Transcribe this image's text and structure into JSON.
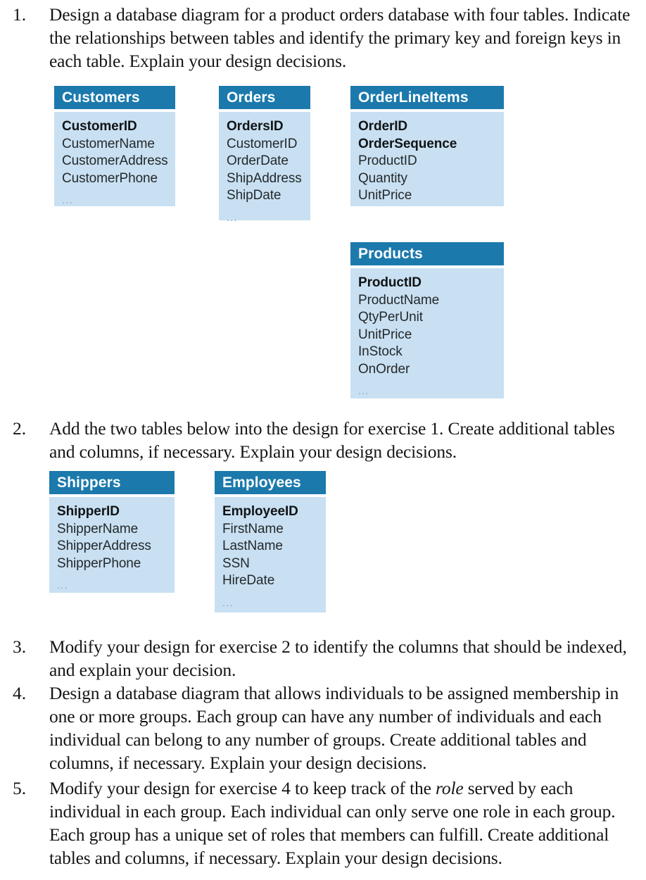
{
  "page": {
    "type": "textbook-exercise-list",
    "colors": {
      "table_header_bg": "#1b79ac",
      "table_body_bg": "#c8e0f2",
      "table_header_text": "#ffffff",
      "body_text": "#151515",
      "ellipsis": "#8aa9c4"
    }
  },
  "exercises": [
    {
      "number": "1.",
      "text": "Design a database diagram for a product orders database with four tables. Indicate the relationships between tables and identify the primary key and foreign keys in each table. Explain your design decisions."
    },
    {
      "number": "2.",
      "text": "Add the two tables below into the design for exercise 1. Create additional tables and columns, if necessary. Explain your design decisions."
    },
    {
      "number": "3.",
      "text": "Modify your design for exercise 2 to identify the columns that should be indexed, and explain your decision."
    },
    {
      "number": "4.",
      "text": "Design a database diagram that allows individuals to be assigned membership in one or more groups. Each group can have any number of individuals and each individual can belong to any number of groups. Create additional tables and columns, if necessary. Explain your design decisions."
    },
    {
      "number": "5.",
      "text_before_italic": "Modify your design for exercise 4 to keep track of the ",
      "italic_word": "role",
      "text_after_italic": " served by each individual in each group. Each individual can only serve one role in each group. Each group has a unique set of roles that members can fulfill. Create additional tables and columns, if necessary. Explain your design decisions."
    }
  ],
  "diagram_exercise_1": {
    "tables": [
      {
        "name": "Customers",
        "columns": [
          {
            "label": "CustomerID",
            "key": true
          },
          {
            "label": "CustomerName",
            "key": false
          },
          {
            "label": "CustomerAddress",
            "key": false
          },
          {
            "label": "CustomerPhone",
            "key": false
          }
        ],
        "ellipsis": "..."
      },
      {
        "name": "Orders",
        "columns": [
          {
            "label": "OrdersID",
            "key": true
          },
          {
            "label": "CustomerID",
            "key": false
          },
          {
            "label": "OrderDate",
            "key": false
          },
          {
            "label": "ShipAddress",
            "key": false
          },
          {
            "label": "ShipDate",
            "key": false
          }
        ],
        "ellipsis": "..."
      },
      {
        "name": "OrderLineItems",
        "columns": [
          {
            "label": "OrderID",
            "key": true
          },
          {
            "label": "OrderSequence",
            "key": true
          },
          {
            "label": "ProductID",
            "key": false
          },
          {
            "label": "Quantity",
            "key": false
          },
          {
            "label": "UnitPrice",
            "key": false
          }
        ],
        "ellipsis": ""
      },
      {
        "name": "Products",
        "columns": [
          {
            "label": "ProductID",
            "key": true
          },
          {
            "label": "ProductName",
            "key": false
          },
          {
            "label": "QtyPerUnit",
            "key": false
          },
          {
            "label": "UnitPrice",
            "key": false
          },
          {
            "label": "InStock",
            "key": false
          },
          {
            "label": "OnOrder",
            "key": false
          }
        ],
        "ellipsis": "..."
      }
    ]
  },
  "diagram_exercise_2": {
    "tables": [
      {
        "name": "Shippers",
        "columns": [
          {
            "label": "ShipperID",
            "key": true
          },
          {
            "label": "ShipperName",
            "key": false
          },
          {
            "label": "ShipperAddress",
            "key": false
          },
          {
            "label": "ShipperPhone",
            "key": false
          }
        ],
        "ellipsis": "..."
      },
      {
        "name": "Employees",
        "columns": [
          {
            "label": "EmployeeID",
            "key": true
          },
          {
            "label": "FirstName",
            "key": false
          },
          {
            "label": "LastName",
            "key": false
          },
          {
            "label": "SSN",
            "key": false
          },
          {
            "label": "HireDate",
            "key": false
          }
        ],
        "ellipsis": "..."
      }
    ]
  }
}
